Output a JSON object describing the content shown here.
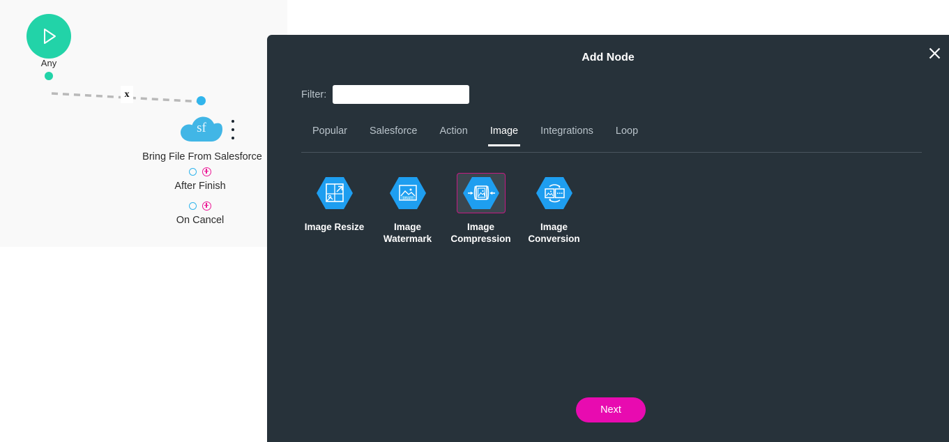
{
  "canvas": {
    "start_node": {
      "label": "Any",
      "icon": "play-icon",
      "color": "#22d3a8"
    },
    "connector": {
      "delete_marker": "x"
    },
    "salesforce_node": {
      "badge_text": "sf",
      "name": "Bring File From Salesforce",
      "icon": "salesforce-cloud-icon",
      "color": "#31b5ec",
      "menu_icon": "kebab-menu-icon",
      "branches": [
        {
          "label": "After Finish"
        },
        {
          "label": "On Cancel"
        }
      ]
    }
  },
  "modal": {
    "title": "Add Node",
    "close_icon": "close-icon",
    "filter": {
      "label": "Filter:",
      "value": "",
      "placeholder": ""
    },
    "tabs": [
      {
        "label": "Popular",
        "active": false
      },
      {
        "label": "Salesforce",
        "active": false
      },
      {
        "label": "Action",
        "active": false
      },
      {
        "label": "Image",
        "active": true
      },
      {
        "label": "Integrations",
        "active": false
      },
      {
        "label": "Loop",
        "active": false
      }
    ],
    "cards": [
      {
        "label": "Image Resize",
        "icon": "image-resize-icon",
        "selected": false
      },
      {
        "label": "Image Watermark",
        "icon": "image-watermark-icon",
        "selected": false
      },
      {
        "label": "Image Compression",
        "icon": "image-compression-icon",
        "selected": true
      },
      {
        "label": "Image Conversion",
        "icon": "image-conversion-icon",
        "selected": false
      }
    ],
    "next_label": "Next",
    "accent_color": "#e80bb0",
    "selection_border_color": "#c41a83",
    "background_color": "#27323a"
  }
}
